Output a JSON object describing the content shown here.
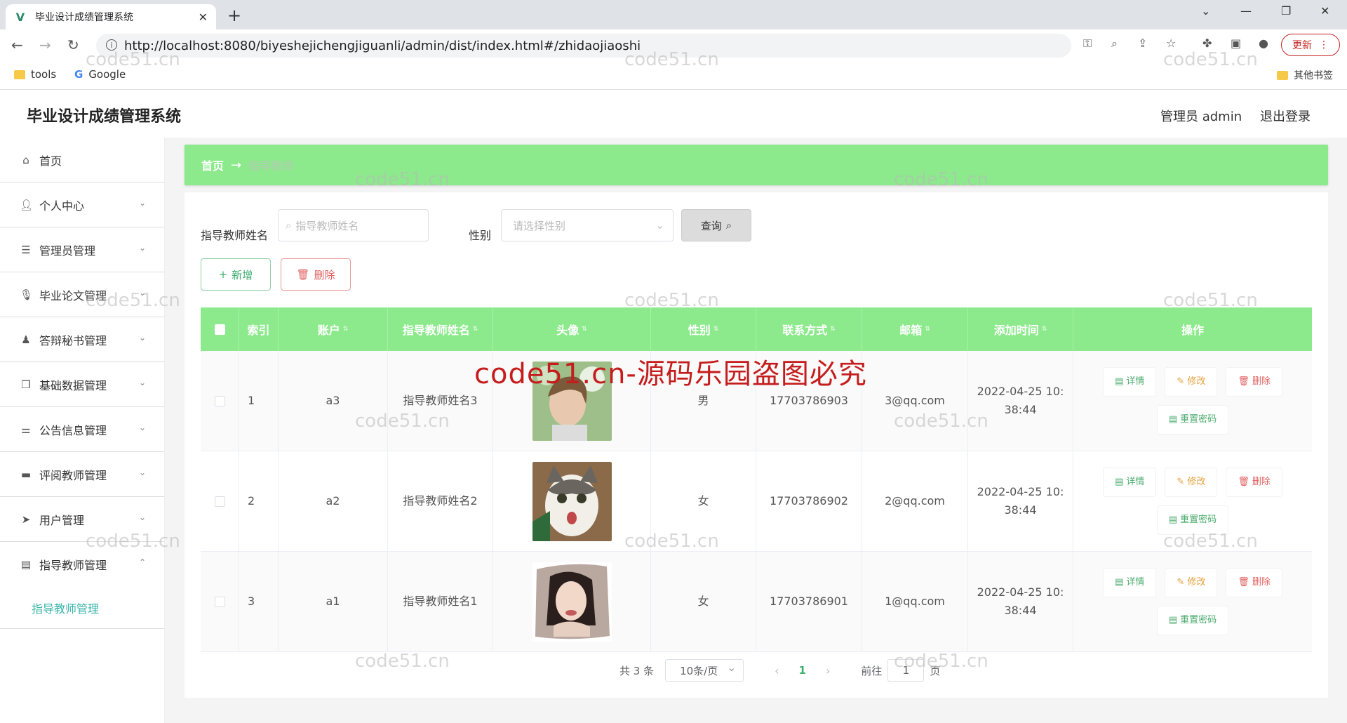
{
  "browser": {
    "tab_title": "毕业设计成绩管理系统",
    "url": "http://localhost:8080/biyeshejichengjiguanli/admin/dist/index.html#/zhidaojiaoshi",
    "update_label": "更新",
    "bookmarks": [
      "tools",
      "Google"
    ],
    "other_bookmarks": "其他书签"
  },
  "header": {
    "title": "毕业设计成绩管理系统",
    "user": "管理员 admin",
    "logout": "退出登录"
  },
  "sidebar": {
    "items": [
      {
        "label": "首页",
        "icon": "home-icon"
      },
      {
        "label": "个人中心",
        "icon": "user-icon"
      },
      {
        "label": "管理员管理",
        "icon": "list-icon"
      },
      {
        "label": "毕业论文管理",
        "icon": "mic-icon"
      },
      {
        "label": "答辩秘书管理",
        "icon": "person-icon"
      },
      {
        "label": "基础数据管理",
        "icon": "copy-icon"
      },
      {
        "label": "公告信息管理",
        "icon": "sliders-icon"
      },
      {
        "label": "评阅教师管理",
        "icon": "monitor-icon"
      },
      {
        "label": "用户管理",
        "icon": "send-icon"
      },
      {
        "label": "指导教师管理",
        "icon": "clipboard-icon"
      }
    ],
    "sub_item": "指导教师管理"
  },
  "breadcrumb": {
    "home": "首页",
    "current": "指导教师"
  },
  "search": {
    "name_label": "指导教师姓名",
    "name_placeholder": "指导教师姓名",
    "gender_label": "性别",
    "gender_placeholder": "请选择性别",
    "query_label": "查询"
  },
  "actions": {
    "add": "新增",
    "delete": "删除"
  },
  "table": {
    "headers": [
      "索引",
      "账户",
      "指导教师姓名",
      "头像",
      "性别",
      "联系方式",
      "邮箱",
      "添加时间",
      "操作"
    ],
    "rows": [
      {
        "index": "1",
        "account": "a3",
        "name": "指导教师姓名3",
        "gender": "男",
        "phone": "17703786903",
        "email": "3@qq.com",
        "time": "2022-04-25 10:38:44"
      },
      {
        "index": "2",
        "account": "a2",
        "name": "指导教师姓名2",
        "gender": "女",
        "phone": "17703786902",
        "email": "2@qq.com",
        "time": "2022-04-25 10:38:44"
      },
      {
        "index": "3",
        "account": "a1",
        "name": "指导教师姓名1",
        "gender": "女",
        "phone": "17703786901",
        "email": "1@qq.com",
        "time": "2022-04-25 10:38:44"
      }
    ],
    "ops": {
      "detail": "详情",
      "edit": "修改",
      "delete": "删除",
      "reset": "重置密码"
    }
  },
  "pagination": {
    "total": "共 3 条",
    "page_size": "10条/页",
    "current": "1",
    "goto_prefix": "前往",
    "goto_value": "1",
    "goto_suffix": "页"
  },
  "watermark": {
    "text": "code51.cn",
    "banner": "code51.cn-源码乐园盗图必究"
  },
  "colors": {
    "accent": "#8cea8c",
    "link": "#36b3a8",
    "danger": "#e06060",
    "warning": "#e6a23c"
  }
}
